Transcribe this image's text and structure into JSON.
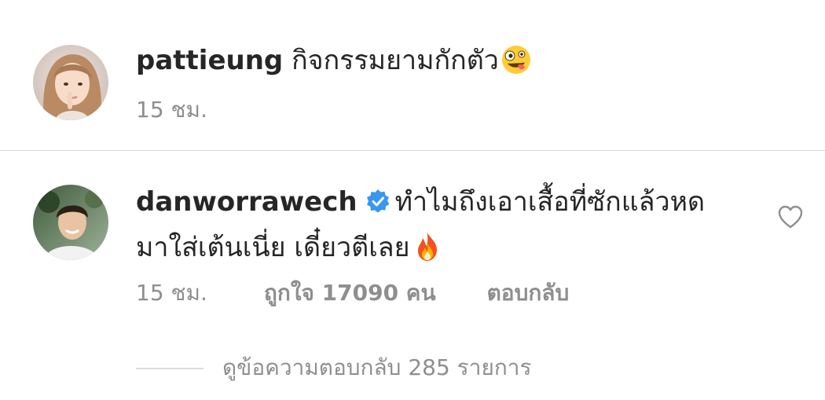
{
  "post": {
    "username": "pattieung",
    "caption": "กิจกรรมยามกักตัว",
    "emoji_icon": "zany-face-icon",
    "time": "15 ชม."
  },
  "comment": {
    "username": "danworrawech",
    "verified_icon": "verified-badge-icon",
    "text_line1": "ทำไมถึงเอาเสื้อที่ซักแล้วหด",
    "text_line2": "มาใส่เต้นเนี่ย เดี๋ยวตีเลย",
    "emoji_icon": "fire-icon",
    "time": "15 ชม.",
    "likes": "ถูกใจ 17090 คน",
    "reply_label": "ตอบกลับ",
    "like_icon": "heart-outline-icon"
  },
  "replies": {
    "view_label": "ดูข้อความตอบกลับ 285 รายการ"
  },
  "colors": {
    "primary_text": "#262626",
    "secondary_text": "#8e8e8e",
    "divider": "#dbdbdb",
    "verified": "#3897f0"
  }
}
